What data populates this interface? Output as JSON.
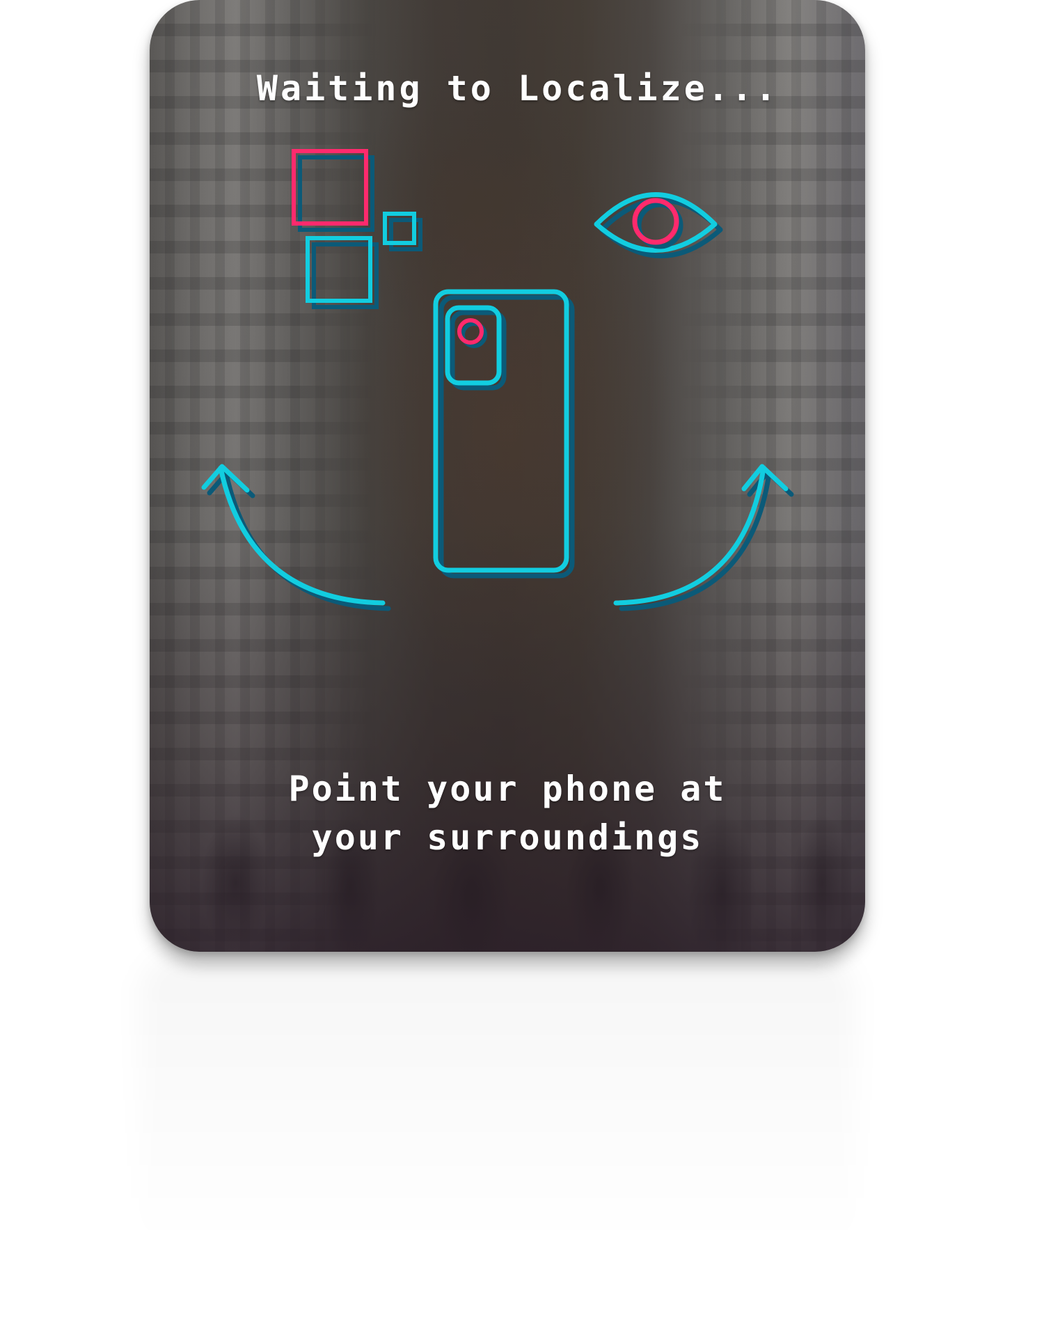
{
  "overlay": {
    "title": "Waiting to Localize...",
    "instruction_line1": "Point your phone at",
    "instruction_line2": "your surroundings"
  },
  "colors": {
    "accent_cyan": "#12cde0",
    "accent_pink": "#ff2a6d",
    "shadow_blue": "#0b5a78",
    "text": "#ffffff"
  },
  "icons": {
    "feature_squares": "feature-squares-icon",
    "eye": "eye-icon",
    "phone": "phone-icon",
    "camera": "camera-icon",
    "arrow_left": "curved-arrow-left-icon",
    "arrow_right": "curved-arrow-right-icon"
  }
}
